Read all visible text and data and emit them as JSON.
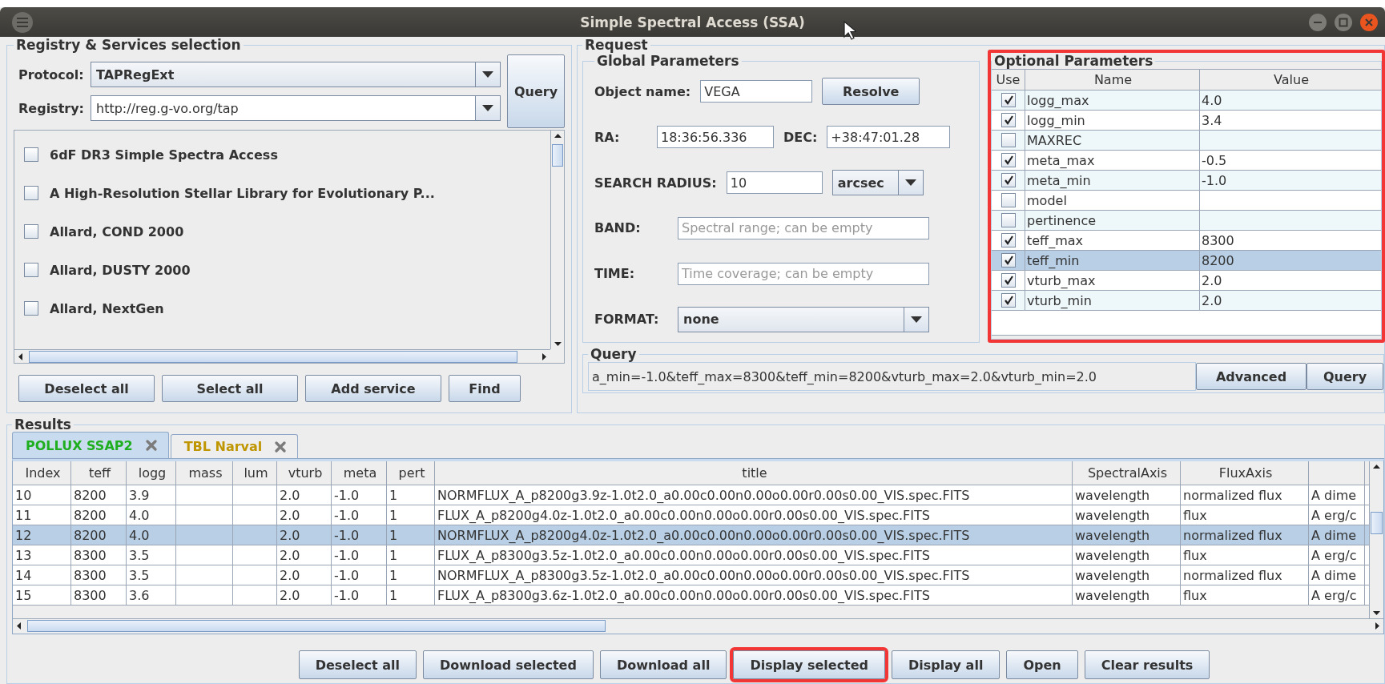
{
  "window": {
    "title": "Simple Spectral Access (SSA)"
  },
  "registry": {
    "legend": "Registry & Services selection",
    "protocol": {
      "label": "Protocol:",
      "value": "TAPRegExt"
    },
    "registry": {
      "label": "Registry:",
      "value": "http://reg.g-vo.org/tap"
    },
    "query_button": "Query",
    "services": [
      {
        "name": "6dF DR3 Simple Spectra Access",
        "checked": false
      },
      {
        "name": "A High-Resolution Stellar Library for Evolutionary P...",
        "checked": false
      },
      {
        "name": "Allard, COND 2000",
        "checked": false
      },
      {
        "name": "Allard, DUSTY 2000",
        "checked": false
      },
      {
        "name": "Allard, NextGen",
        "checked": false
      }
    ],
    "buttons": [
      "Deselect all",
      "Select all",
      "Add service",
      "Find"
    ]
  },
  "request": {
    "legend": "Request",
    "global": {
      "legend": "Global Parameters",
      "object_name": {
        "label": "Object name:",
        "value": "VEGA"
      },
      "resolve_button": "Resolve",
      "ra": {
        "label": "RA:",
        "value": "18:36:56.336"
      },
      "dec": {
        "label": "DEC:",
        "value": "+38:47:01.28"
      },
      "search_radius": {
        "label": "SEARCH RADIUS:",
        "value": "10",
        "unit": "arcsec"
      },
      "band": {
        "label": "BAND:",
        "placeholder": "Spectral range; can be empty"
      },
      "time": {
        "label": "TIME:",
        "placeholder": "Time coverage; can be empty"
      },
      "format": {
        "label": "FORMAT:",
        "value": "none"
      }
    },
    "optional": {
      "legend": "Optional Parameters",
      "highlighted": true,
      "columns": [
        "Use",
        "Name",
        "Value"
      ],
      "rows": [
        {
          "name": "logg_max",
          "value": "4.0",
          "checked": true,
          "selected": false
        },
        {
          "name": "logg_min",
          "value": "3.4",
          "checked": true,
          "selected": false
        },
        {
          "name": "MAXREC",
          "checked": false,
          "selected": false
        },
        {
          "name": "meta_max",
          "value": "-0.5",
          "checked": true,
          "selected": false
        },
        {
          "name": "meta_min",
          "value": "-1.0",
          "checked": true,
          "selected": false
        },
        {
          "name": "model",
          "checked": false,
          "selected": false
        },
        {
          "name": "pertinence",
          "checked": false,
          "selected": false
        },
        {
          "name": "teff_max",
          "value": "8300",
          "checked": true,
          "selected": false
        },
        {
          "name": "teff_min",
          "value": "8200",
          "checked": true,
          "selected": true
        },
        {
          "name": "vturb_max",
          "value": "2.0",
          "checked": true,
          "selected": false
        },
        {
          "name": "vturb_min",
          "value": "2.0",
          "checked": true,
          "selected": false
        }
      ]
    },
    "query": {
      "legend": "Query",
      "text": "a_min=-1.0&teff_max=8300&teff_min=8200&vturb_max=2.0&vturb_min=2.0",
      "buttons": [
        "Advanced",
        "Query"
      ]
    }
  },
  "results": {
    "legend": "Results",
    "tabs": [
      {
        "label": "POLLUX SSAP2",
        "color": "#1fae1f",
        "selected": true
      },
      {
        "label": "TBL Narval",
        "color": "#bf9600",
        "selected": false
      }
    ],
    "table": {
      "columns": [
        "Index",
        "teff",
        "logg",
        "mass",
        "lum",
        "vturb",
        "meta",
        "pert",
        "title",
        "SpectralAxis",
        "FluxAxis",
        null
      ],
      "rows": [
        {
          "selected": false,
          "cells": [
            "10",
            "8200",
            "3.9",
            null,
            null,
            "2.0",
            "-1.0",
            "1",
            "NORMFLUX_A_p8200g3.9z-1.0t2.0_a0.00c0.00n0.00o0.00r0.00s0.00_VIS.spec.FITS",
            "wavelength",
            "normalized flux",
            "A dime"
          ]
        },
        {
          "selected": false,
          "cells": [
            "11",
            "8200",
            "4.0",
            null,
            null,
            "2.0",
            "-1.0",
            "1",
            "FLUX_A_p8200g4.0z-1.0t2.0_a0.00c0.00n0.00o0.00r0.00s0.00_VIS.spec.FITS",
            "wavelength",
            "flux",
            "A erg/c"
          ]
        },
        {
          "selected": true,
          "cells": [
            "12",
            "8200",
            "4.0",
            null,
            null,
            "2.0",
            "-1.0",
            "1",
            "NORMFLUX_A_p8200g4.0z-1.0t2.0_a0.00c0.00n0.00o0.00r0.00s0.00_VIS.spec.FITS",
            "wavelength",
            "normalized flux",
            "A dime"
          ]
        },
        {
          "selected": false,
          "cells": [
            "13",
            "8300",
            "3.5",
            null,
            null,
            "2.0",
            "-1.0",
            "1",
            "FLUX_A_p8300g3.5z-1.0t2.0_a0.00c0.00n0.00o0.00r0.00s0.00_VIS.spec.FITS",
            "wavelength",
            "flux",
            "A erg/c"
          ]
        },
        {
          "selected": false,
          "cells": [
            "14",
            "8300",
            "3.5",
            null,
            null,
            "2.0",
            "-1.0",
            "1",
            "NORMFLUX_A_p8300g3.5z-1.0t2.0_a0.00c0.00n0.00o0.00r0.00s0.00_VIS.spec.FITS",
            "wavelength",
            "normalized flux",
            "A dime"
          ]
        },
        {
          "selected": false,
          "cells": [
            "15",
            "8300",
            "3.6",
            null,
            null,
            "2.0",
            "-1.0",
            "1",
            "FLUX_A_p8300g3.6z-1.0t2.0_a0.00c0.00n0.00o0.00r0.00s0.00_VIS.spec.FITS",
            "wavelength",
            "flux",
            "A erg/c"
          ]
        }
      ]
    },
    "buttons": [
      {
        "label": "Deselect all",
        "highlighted": false
      },
      {
        "label": "Download selected",
        "highlighted": false
      },
      {
        "label": "Download all",
        "highlighted": false
      },
      {
        "label": "Display selected",
        "highlighted": true
      },
      {
        "label": "Display all",
        "highlighted": false
      },
      {
        "label": "Open",
        "highlighted": false
      },
      {
        "label": "Clear results",
        "highlighted": false
      }
    ]
  }
}
